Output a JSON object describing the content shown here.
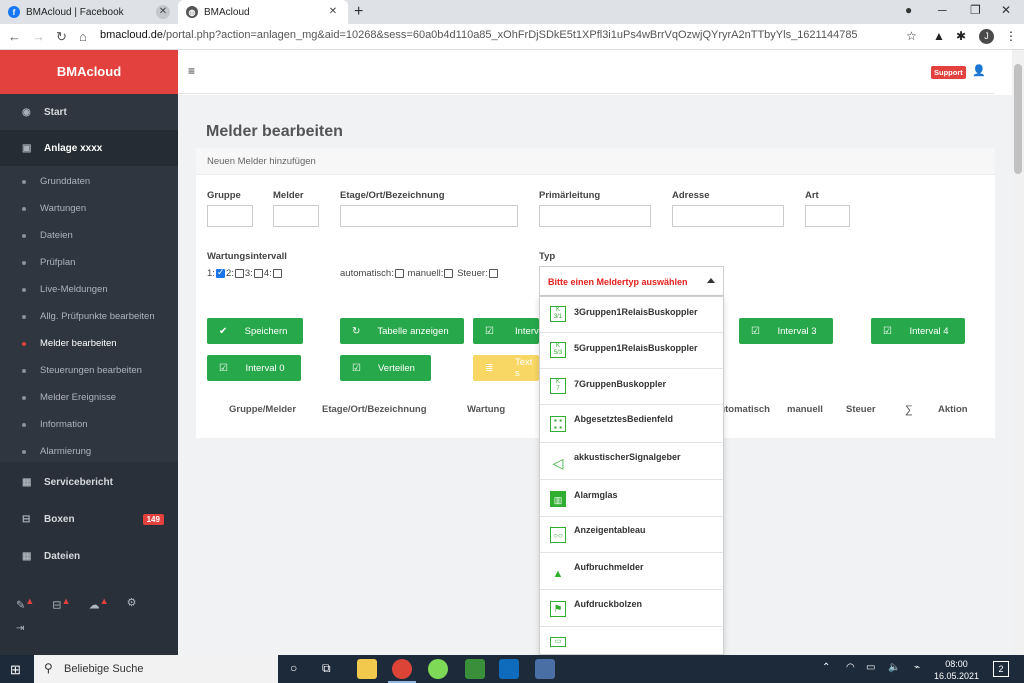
{
  "browser": {
    "tabs": [
      {
        "title": "BMAcloud | Facebook",
        "icon": "facebook-icon"
      },
      {
        "title": "BMAcloud",
        "icon": "globe-icon"
      }
    ],
    "url_host": "bmacloud.de",
    "url_rest": "/portal.php?action=anlagen_mg&aid=10268&sess=60a0b4d110a85_xOhFrDjSDkE5t1XPfl3i1uPs4wBrrVqOzwjQYryrA2nTTbyYls_1621144785",
    "profile_initial": "J"
  },
  "app": {
    "brand": "BMAcloud",
    "support_label": "Support",
    "sidebar": {
      "main": [
        {
          "label": "Start",
          "icon": "dashboard-icon"
        },
        {
          "label": "Anlage xxxx",
          "icon": "chart-icon"
        }
      ],
      "sub": [
        "Grunddaten",
        "Wartungen",
        "Dateien",
        "Prüfplan",
        "Live-Meldungen",
        "Allg. Prüfpunkte bearbeiten",
        "Melder bearbeiten",
        "Steuerungen bearbeiten",
        "Melder Ereignisse",
        "Information",
        "Alarmierung"
      ],
      "current_sub": "Melder bearbeiten",
      "lower": [
        {
          "label": "Servicebericht",
          "icon": "table-icon"
        },
        {
          "label": "Boxen",
          "icon": "box-icon",
          "badge": "149"
        },
        {
          "label": "Dateien",
          "icon": "table-icon"
        }
      ]
    },
    "page_title": "Melder bearbeiten",
    "card_header": "Neuen Melder hinzufügen",
    "form": {
      "labels": {
        "gruppe": "Gruppe",
        "melder": "Melder",
        "etage": "Etage/Ort/Bezeichnung",
        "primaer": "Primärleitung",
        "adresse": "Adresse",
        "art": "Art",
        "wartung": "Wartungsintervall",
        "typ": "Typ"
      },
      "interval_checks": [
        {
          "label": "1:",
          "checked": true
        },
        {
          "label": "2:",
          "checked": false
        },
        {
          "label": "3:",
          "checked": false
        },
        {
          "label": "4:",
          "checked": false
        }
      ],
      "mode_checks": [
        {
          "label": "automatisch:",
          "checked": false
        },
        {
          "label": "manuell:",
          "checked": false
        },
        {
          "label": "Steuer:",
          "checked": false
        }
      ]
    },
    "buttons": {
      "speichern": "Speichern",
      "tabelle": "Tabelle anzeigen",
      "interval1_partial": "Interv",
      "interval3": "Interval 3",
      "interval4": "Interval 4",
      "interval0": "Interval 0",
      "verteilen": "Verteilen",
      "text_partial": "Text s"
    },
    "table_headers": {
      "gruppe": "Gruppe/Melder",
      "etage": "Etage/Ort/Bezeichnung",
      "wartung": "Wartung",
      "automatisch": "Automatisch",
      "manuell": "manuell",
      "steuer": "Steuer",
      "sum": "∑",
      "aktion": "Aktion"
    },
    "dropdown": {
      "placeholder": "Bitte einen Meldertyp auswählen",
      "items": [
        {
          "label": "3Gruppen1RelaisBuskoppler",
          "icon": "buskoppler-icon"
        },
        {
          "label": "5Gruppen1RelaisBuskoppler",
          "icon": "buskoppler-icon"
        },
        {
          "label": "7GruppenBuskoppler",
          "icon": "buskoppler-icon"
        },
        {
          "label": "AbgesetztesBedienfeld",
          "icon": "control-panel-icon"
        },
        {
          "label": "akkustischerSignalgeber",
          "icon": "horn-icon"
        },
        {
          "label": "Alarmglas",
          "icon": "alarm-glass-icon"
        },
        {
          "label": "Anzeigentableau",
          "icon": "tableau-icon"
        },
        {
          "label": "Aufbruchmelder",
          "icon": "triangle-icon"
        },
        {
          "label": "Aufdruckbolzen",
          "icon": "flag-icon"
        },
        {
          "label": "",
          "icon": "module-icon"
        }
      ]
    }
  },
  "taskbar": {
    "search_placeholder": "Beliebige Suche",
    "time": "08:00",
    "date": "16.05.2021",
    "notifications": "2"
  }
}
